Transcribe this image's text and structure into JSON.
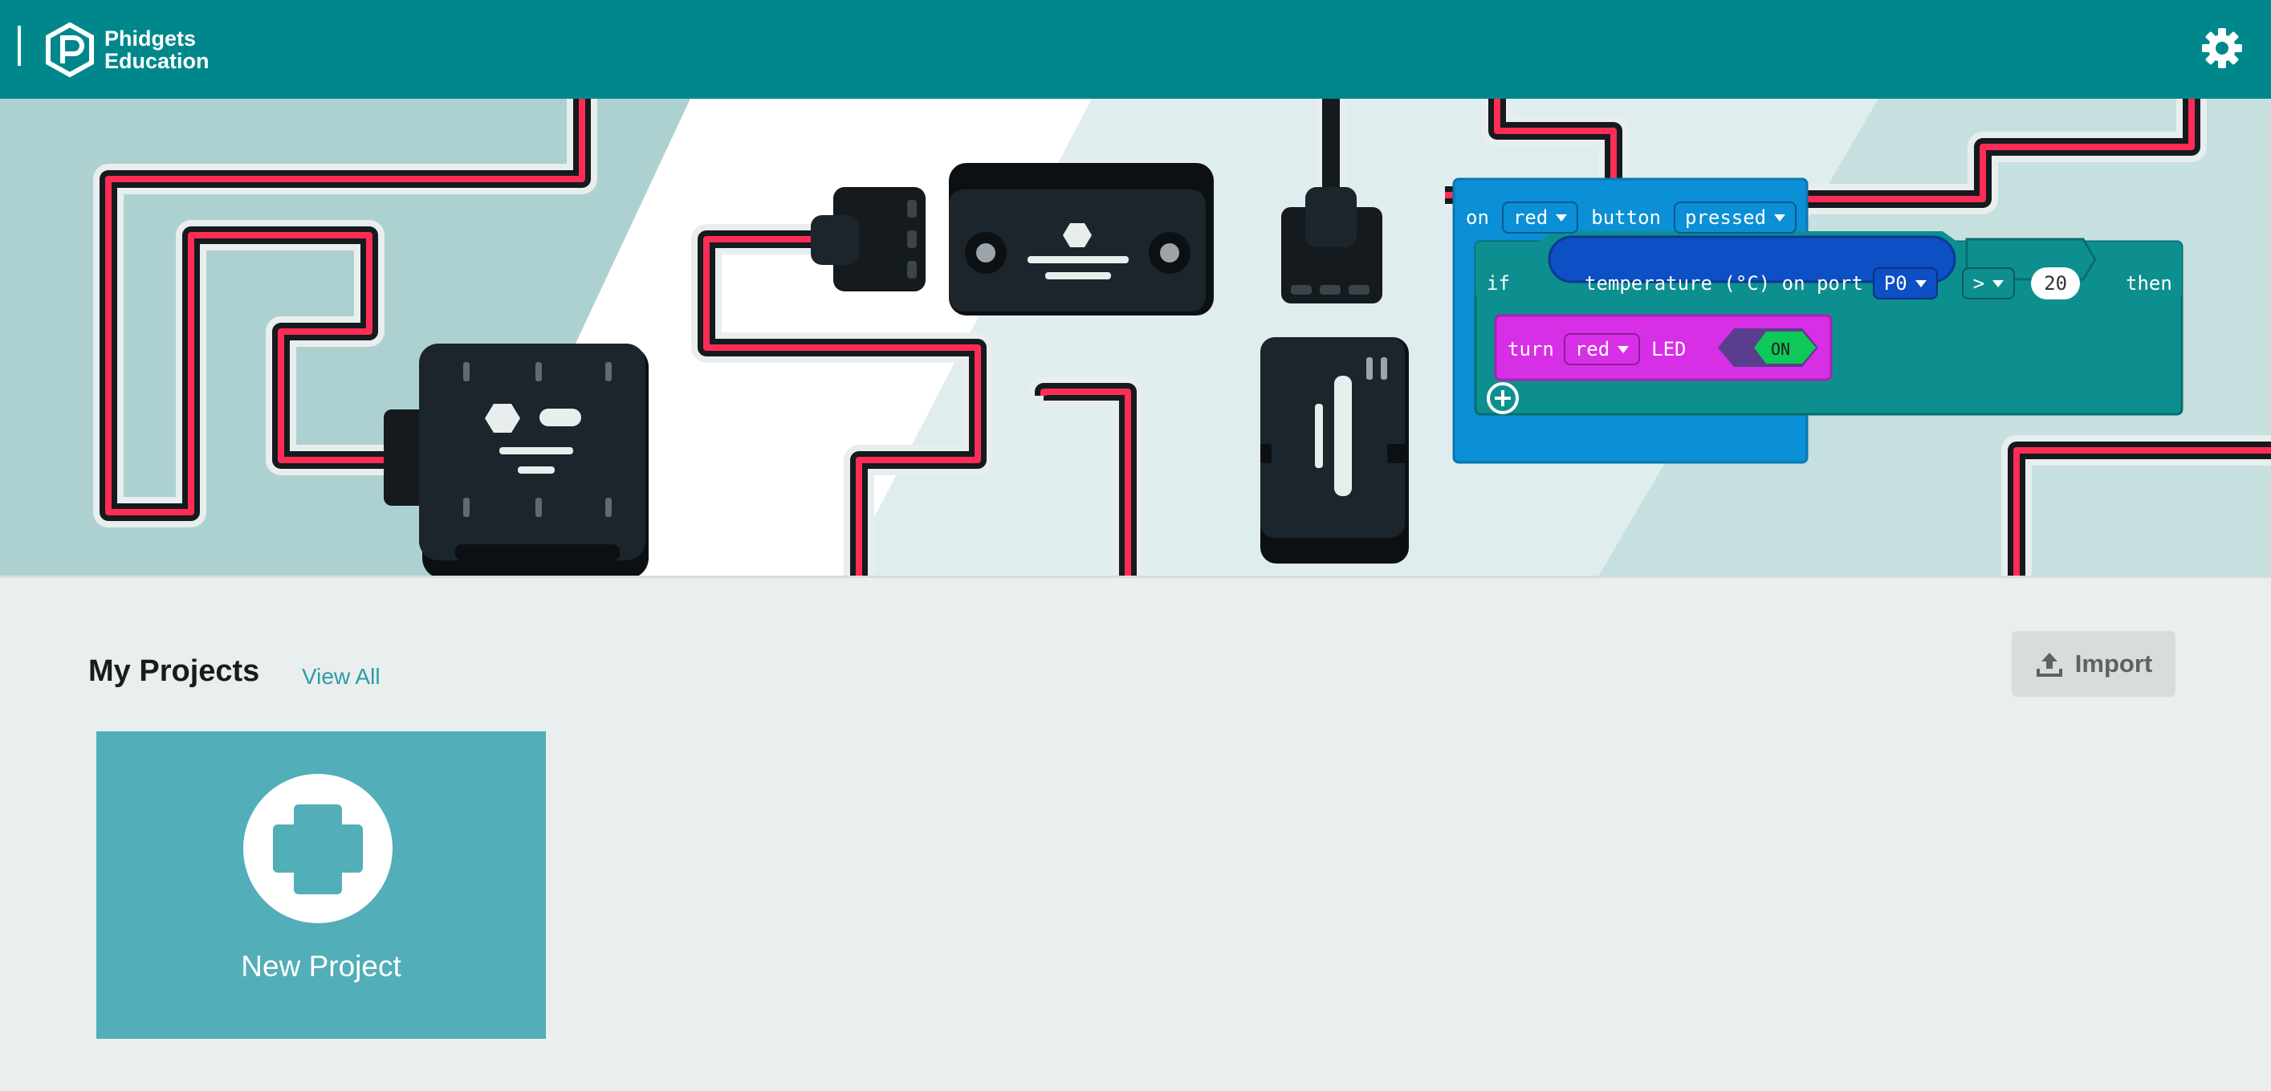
{
  "header": {
    "logo_line1": "Phidgets",
    "logo_line2": "Education",
    "settings_icon": "gear-icon",
    "color": "#00878c"
  },
  "hero": {
    "block_on": "on",
    "block_on_dropdown": "red",
    "block_button": "button",
    "block_pressed_dropdown": "pressed",
    "block_if": "if",
    "block_temperature": "temperature (°C) on port",
    "block_port_dropdown": "P0",
    "block_operator": ">",
    "block_value": "20",
    "block_then": "then",
    "block_turn": "turn",
    "block_turn_dropdown": "red",
    "block_led": "LED",
    "block_on_toggle": "ON"
  },
  "projects": {
    "title": "My Projects",
    "view_all": "View All",
    "import_label": "Import",
    "import_icon": "upload-icon",
    "new_project_label": "New Project",
    "new_project_icon": "plus-icon",
    "card_color": "#52aeb8"
  }
}
